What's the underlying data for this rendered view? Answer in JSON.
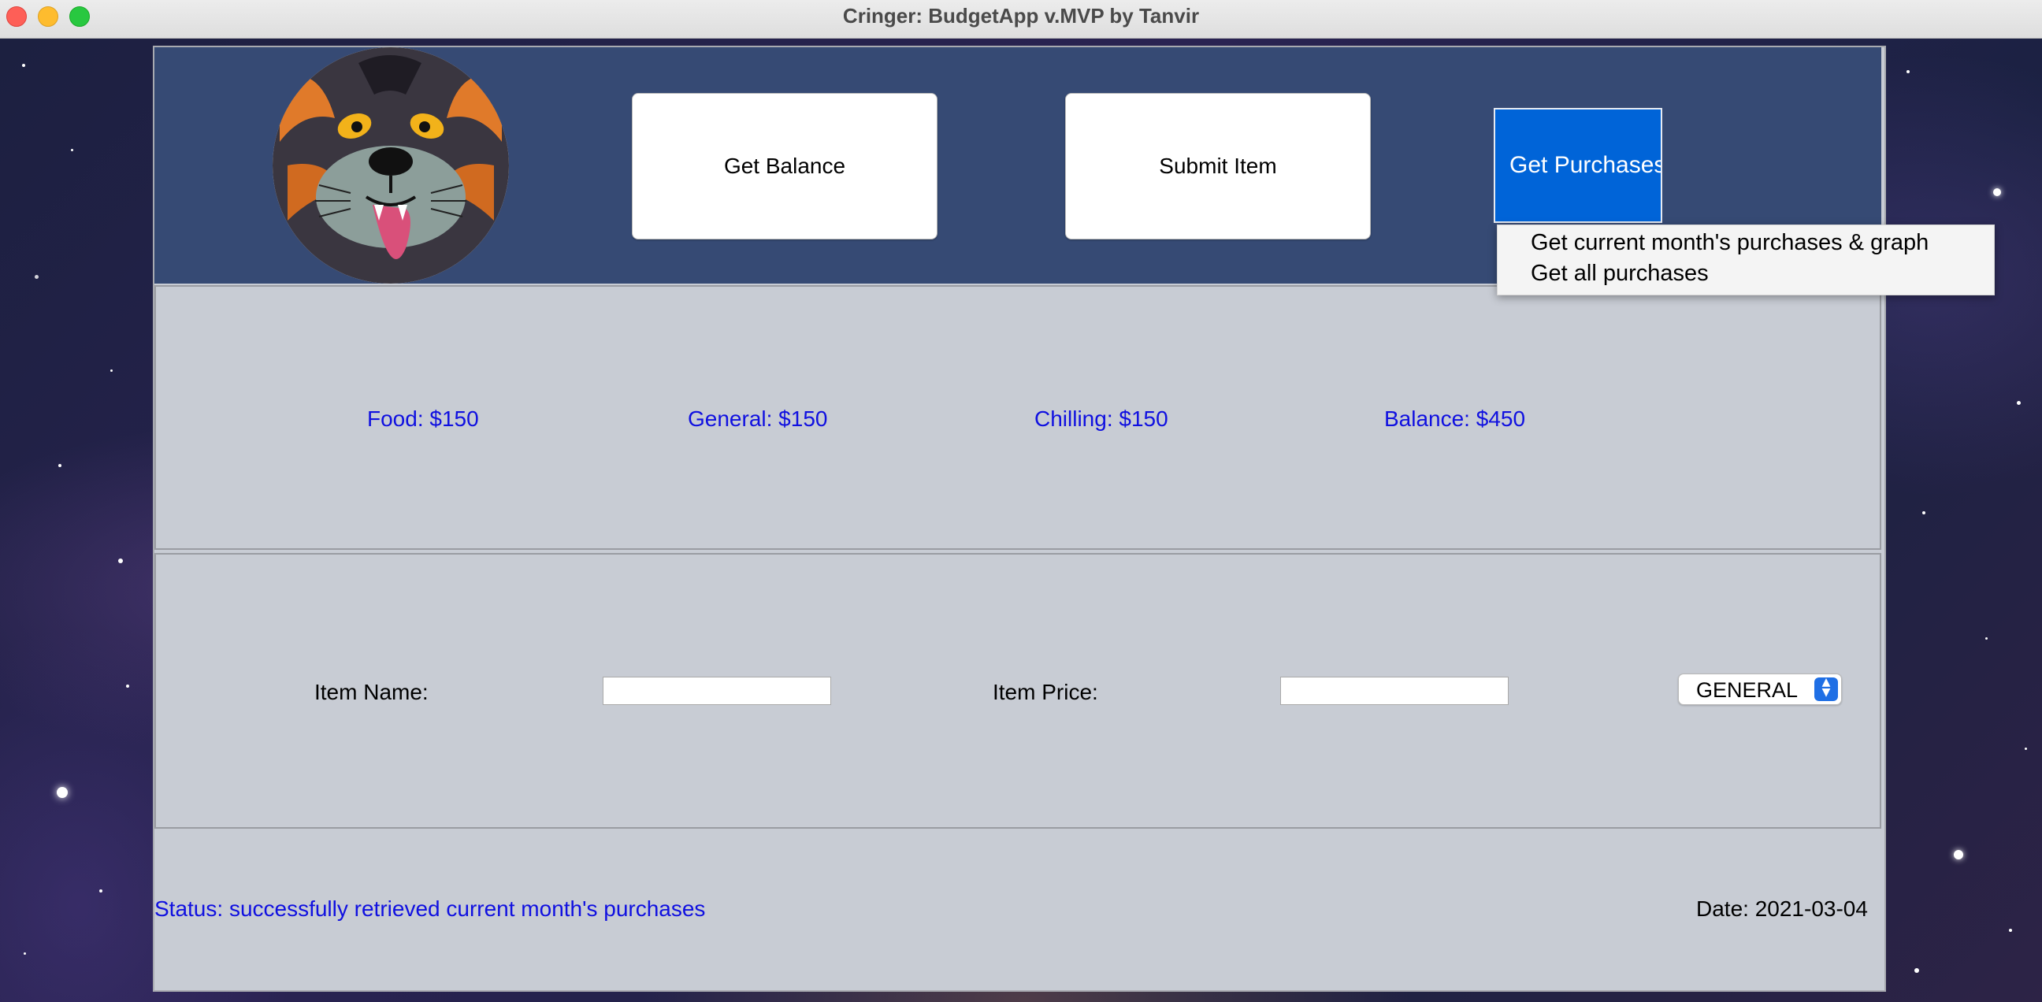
{
  "window": {
    "title": "Cringer: BudgetApp v.MVP by Tanvir"
  },
  "toolbar": {
    "get_balance_label": "Get Balance",
    "submit_item_label": "Submit Item",
    "get_purchases_label": "Get Purchases"
  },
  "purchases_menu": {
    "items": [
      "Get current month's purchases & graph",
      "Get all purchases"
    ]
  },
  "balances": {
    "food": "Food: $150",
    "general": "General: $150",
    "chilling": "Chilling: $150",
    "balance": "Balance: $450"
  },
  "item_form": {
    "name_label": "Item Name:",
    "name_value": "",
    "price_label": "Item Price:",
    "price_value": "",
    "category_selected": "GENERAL"
  },
  "status_bar": {
    "status": "Status: successfully retrieved current month's purchases",
    "date": "Date: 2021-03-04"
  },
  "colors": {
    "header_bg": "#364a74",
    "panel_bg": "#c8ccd4",
    "accent_blue": "#0064d8",
    "label_blue": "#1010e0"
  },
  "icons": {
    "mascot": "cringer-tiger-mascot",
    "combo": "up-down-chevron-icon"
  }
}
